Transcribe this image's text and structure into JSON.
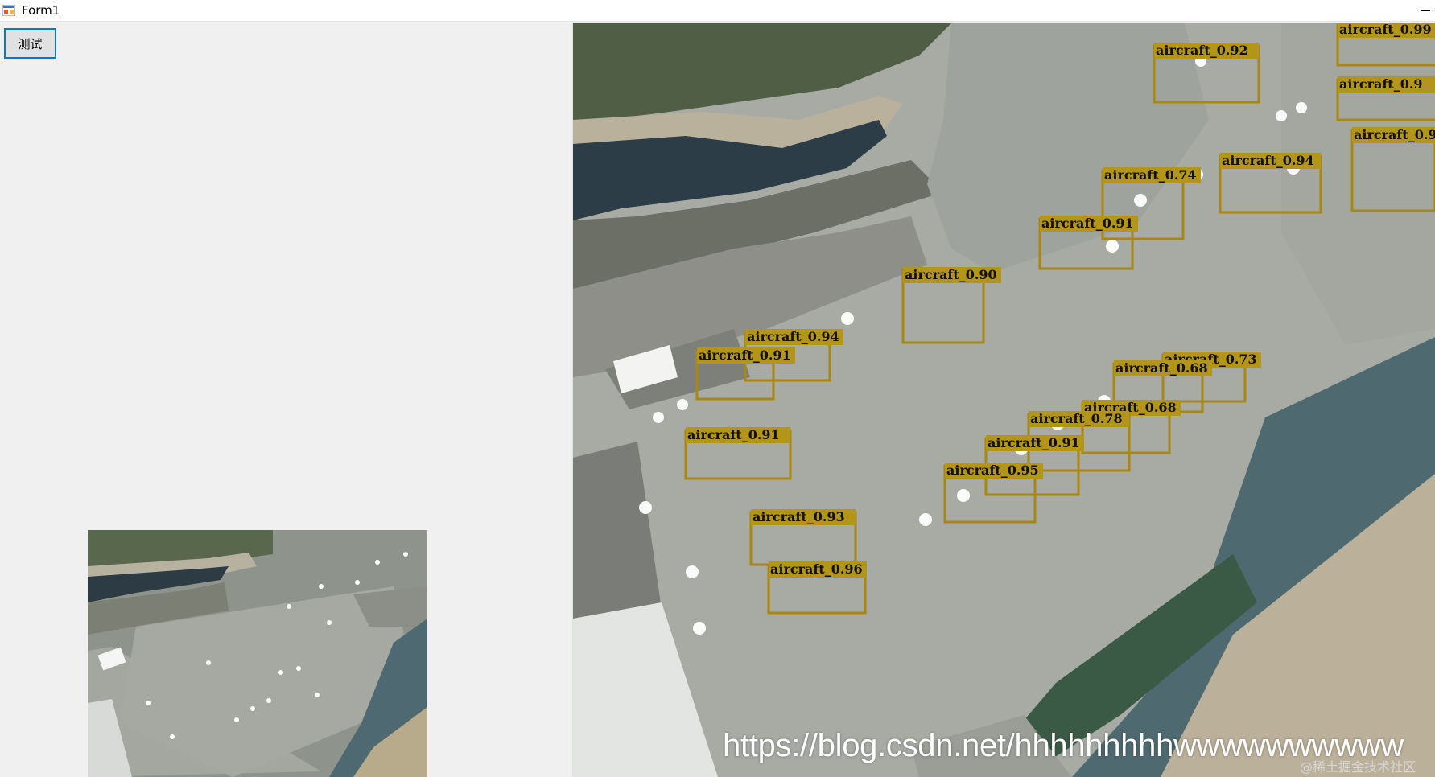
{
  "window": {
    "title": "Form1"
  },
  "toolbar": {
    "test_button_label": "测试"
  },
  "detections": [
    {
      "label": "aircraft_0.92"
    },
    {
      "label": "aircraft_0.99"
    },
    {
      "label": "aircraft_0.9"
    },
    {
      "label": "aircraft_0.9"
    },
    {
      "label": "aircraft_0.94"
    },
    {
      "label": "aircraft_0.74"
    },
    {
      "label": "aircraft_0.91"
    },
    {
      "label": "aircraft_0.90"
    },
    {
      "label": "aircraft_0.94"
    },
    {
      "label": "aircraft_0.91"
    },
    {
      "label": "aircraft_0.73"
    },
    {
      "label": "aircraft_0.68"
    },
    {
      "label": "aircraft_0.68"
    },
    {
      "label": "aircraft_0.78"
    },
    {
      "label": "aircraft_0.91"
    },
    {
      "label": "aircraft_0.91"
    },
    {
      "label": "aircraft_0.95"
    },
    {
      "label": "aircraft_0.93"
    },
    {
      "label": "aircraft_0.96"
    }
  ],
  "watermark": {
    "url": "https://blog.csdn.net/hhhhhhhhhwwwwwwwwww",
    "site": "@稀土掘金技术社区"
  }
}
